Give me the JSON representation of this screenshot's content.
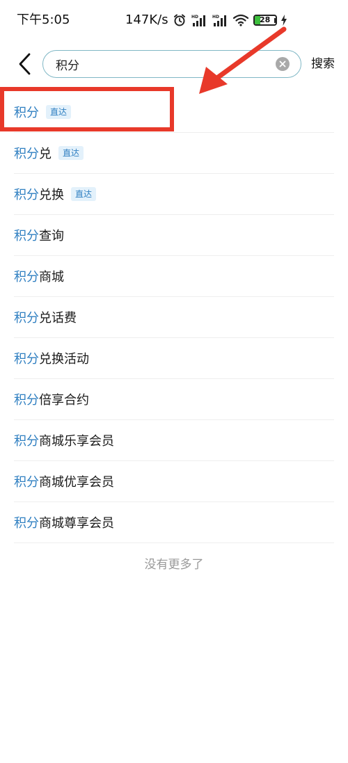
{
  "status_bar": {
    "time": "下午5:05",
    "net_speed": "147K/s",
    "battery_level": "28",
    "icons": [
      "alarm-icon",
      "hd-signal-icon",
      "hd-signal-icon",
      "wifi-icon",
      "battery-icon",
      "charging-icon"
    ]
  },
  "search": {
    "back_icon": "chevron-left-icon",
    "query": "积分",
    "clear_icon": "clear-circle-icon",
    "submit_label": "搜索"
  },
  "suggestions": [
    {
      "keyword": "积分",
      "rest": "",
      "tag": "直达"
    },
    {
      "keyword": "积分",
      "rest": "兑",
      "tag": "直达"
    },
    {
      "keyword": "积分",
      "rest": "兑换",
      "tag": "直达"
    },
    {
      "keyword": "积分",
      "rest": "查询",
      "tag": ""
    },
    {
      "keyword": "积分",
      "rest": "商城",
      "tag": ""
    },
    {
      "keyword": "积分",
      "rest": "兑话费",
      "tag": ""
    },
    {
      "keyword": "积分",
      "rest": "兑换活动",
      "tag": ""
    },
    {
      "keyword": "积分",
      "rest": "倍享合约",
      "tag": ""
    },
    {
      "keyword": "积分",
      "rest": "商城乐享会员",
      "tag": ""
    },
    {
      "keyword": "积分",
      "rest": "商城优享会员",
      "tag": ""
    },
    {
      "keyword": "积分",
      "rest": "商城尊享会员",
      "tag": ""
    }
  ],
  "no_more_text": "没有更多了",
  "colors": {
    "keyword_highlight": "#2f7fc1",
    "tag_background": "#e3f1fb",
    "search_border": "#7fb7c5",
    "annotation_red": "#e8392a"
  }
}
